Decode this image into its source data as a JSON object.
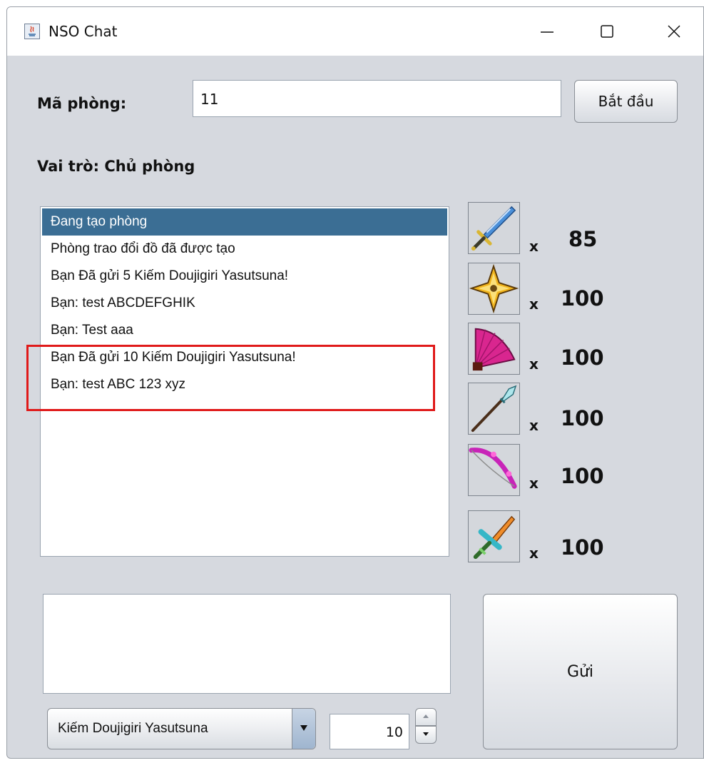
{
  "window": {
    "title": "NSO Chat"
  },
  "room": {
    "label": "Mã phòng:",
    "code": "11",
    "start_button": "Bắt đầu"
  },
  "role": {
    "text": "Vai trò: Chủ phòng"
  },
  "log": {
    "items": [
      "Đang tạo phòng",
      "Phòng trao đổi đồ đã được tạo",
      "Bạn Đã gửi 5 Kiếm Doujigiri Yasutsuna!",
      "Bạn: test ABCDEFGHIK",
      "Bạn: Test aaa",
      "Bạn Đã gửi 10 Kiếm Doujigiri Yasutsuna!",
      "Bạn: test ABC 123 xyz"
    ],
    "selected_index": 0
  },
  "inventory": [
    {
      "icon": "sword-icon",
      "x": "x",
      "qty": "85"
    },
    {
      "icon": "shuriken-icon",
      "x": "x",
      "qty": "100"
    },
    {
      "icon": "fan-icon",
      "x": "x",
      "qty": "100"
    },
    {
      "icon": "spear-icon",
      "x": "x",
      "qty": "100"
    },
    {
      "icon": "bow-icon",
      "x": "x",
      "qty": "100"
    },
    {
      "icon": "dagger-icon",
      "x": "x",
      "qty": "100"
    }
  ],
  "message": {
    "value": ""
  },
  "send_button": "Gửi",
  "item_select": {
    "selected": "Kiếm Doujigiri Yasutsuna"
  },
  "quantity": {
    "value": "10"
  },
  "colors": {
    "window_bg": "#d6d9df",
    "selection": "#3b6e94",
    "highlight": "#e01a1a"
  }
}
